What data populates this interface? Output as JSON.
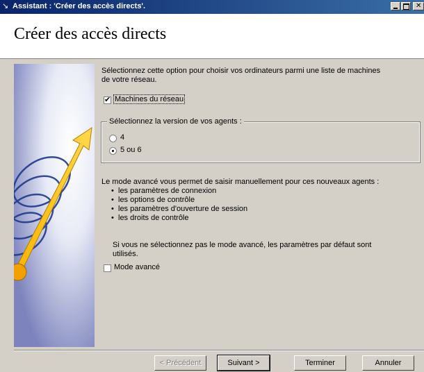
{
  "window": {
    "title": "Assistant : 'Créer des accès directs'.",
    "buttons": [
      "minimize",
      "maximize",
      "close"
    ]
  },
  "header": {
    "title": "Créer des accès directs"
  },
  "side_image": {
    "icon_name": "wizard-illustration-icon"
  },
  "body": {
    "intro_line1": "Sélectionnez cette option pour choisir vos ordinateurs parmi une liste de machines",
    "intro_line2": "de votre réseau.",
    "network_checkbox": {
      "label": "Machines du réseau",
      "checked": true
    },
    "agent_group": {
      "legend": "Sélectionnez la version de vos agents :",
      "options": [
        {
          "label": "4",
          "selected": false
        },
        {
          "label": "5 ou 6",
          "selected": true
        }
      ]
    },
    "advanced_intro": "Le mode avancé vous permet de saisir manuellement pour ces nouveaux agents :",
    "advanced_items": [
      "les paramètres de connexion",
      "les options de contrôle",
      "les paramètres d'ouverture de session",
      "les droits de contrôle"
    ],
    "default_note_line1": "Si vous ne sélectionnez pas le mode avancé, les paramètres par défaut sont",
    "default_note_line2": "utilisés.",
    "advanced_checkbox": {
      "label": "Mode avancé",
      "checked": false
    }
  },
  "footer": {
    "previous": "< Précédent",
    "next": "Suivant >",
    "finish": "Terminer",
    "cancel": "Annuler"
  }
}
